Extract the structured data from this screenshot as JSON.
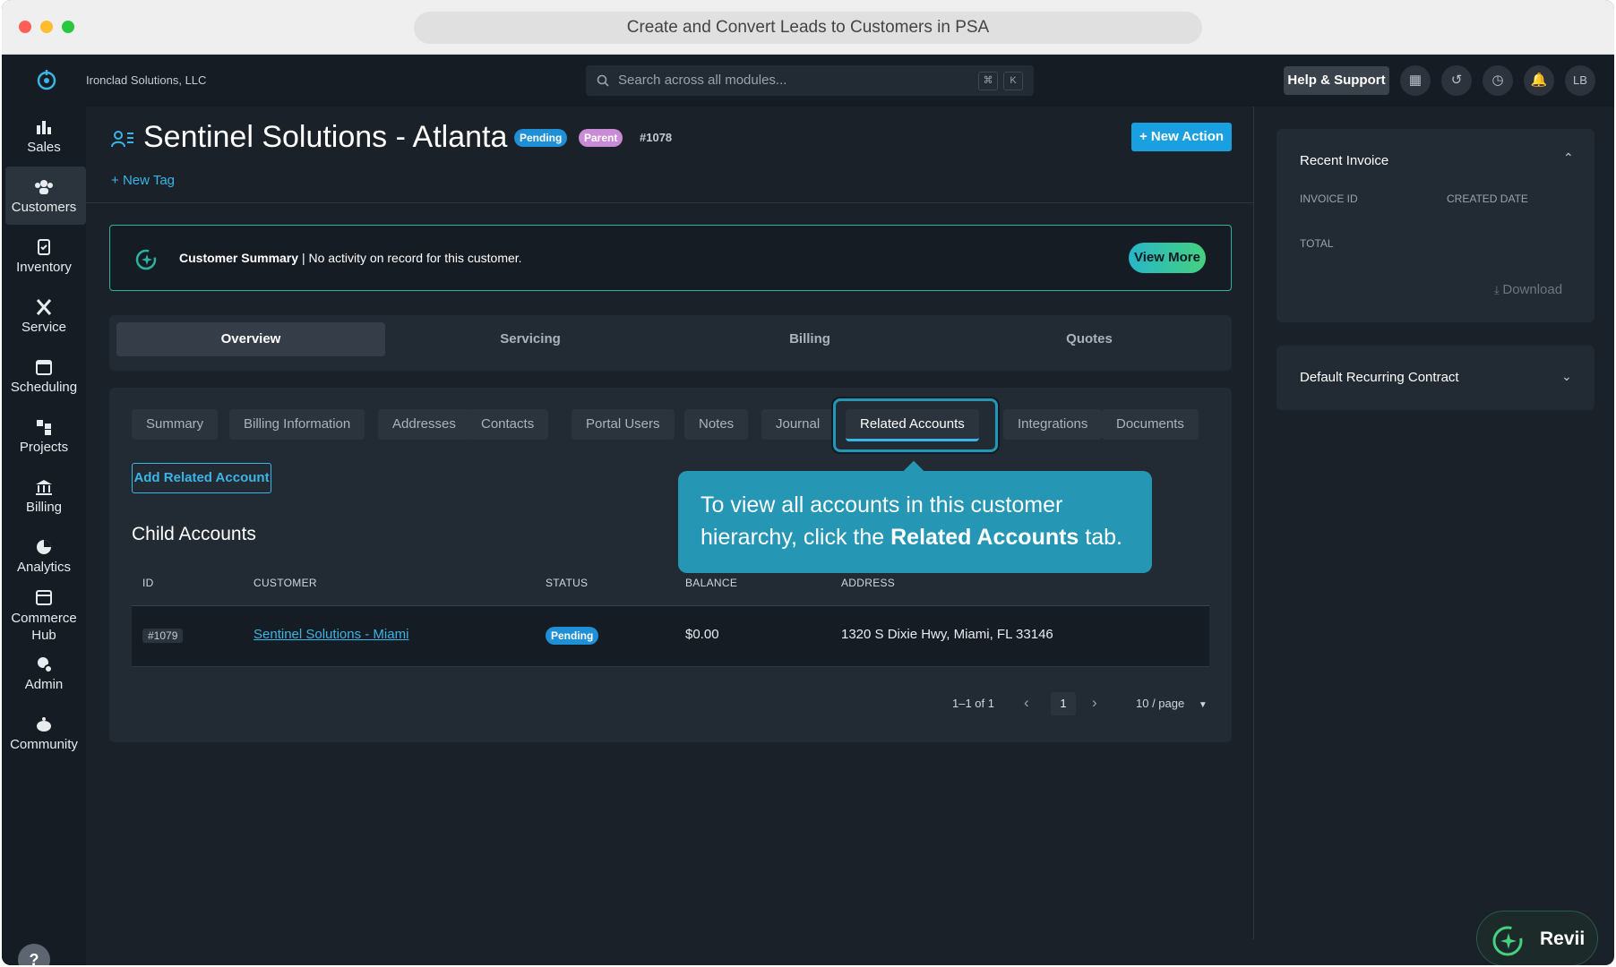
{
  "window": {
    "title": "Create and Convert Leads to Customers in PSA"
  },
  "header": {
    "org_name": "Ironclad Solutions, LLC",
    "search_placeholder": "Search across all modules...",
    "shortcut_keys": [
      "⌘",
      "K"
    ],
    "help_label": "Help & Support",
    "avatar_initials": "LB"
  },
  "sidebar": {
    "items": [
      {
        "label": "Sales",
        "icon": "bar-chart-icon"
      },
      {
        "label": "Customers",
        "icon": "users-icon",
        "active": true
      },
      {
        "label": "Inventory",
        "icon": "clipboard-icon"
      },
      {
        "label": "Service",
        "icon": "tools-icon"
      },
      {
        "label": "Scheduling",
        "icon": "calendar-icon"
      },
      {
        "label": "Projects",
        "icon": "projects-icon"
      },
      {
        "label": "Billing",
        "icon": "bank-icon"
      },
      {
        "label": "Analytics",
        "icon": "pie-chart-icon"
      },
      {
        "label": "Commerce",
        "label2": "Hub",
        "icon": "store-icon"
      },
      {
        "label": "Admin",
        "icon": "admin-icon"
      },
      {
        "label": "Community",
        "icon": "community-icon"
      }
    ],
    "help_glyph": "?"
  },
  "customer": {
    "name": "Sentinel Solutions - Atlanta",
    "status_badge": "Pending",
    "type_badge": "Parent",
    "number": "#1078",
    "new_tag_label": "New Tag",
    "new_action_label": "New Action"
  },
  "summary": {
    "title": "Customer Summary",
    "separator": "|",
    "message": "No activity on record for this customer.",
    "view_more": "View More"
  },
  "main_tabs": [
    "Overview",
    "Servicing",
    "Billing",
    "Quotes"
  ],
  "sub_tabs": [
    "Summary",
    "Billing Information",
    "Addresses",
    "Contacts",
    "Portal Users",
    "Notes",
    "Journal",
    "Related Accounts",
    "Integrations",
    "Documents"
  ],
  "related": {
    "add_button": "Add Related Account",
    "section_title": "Child Accounts",
    "columns": [
      "ID",
      "CUSTOMER",
      "STATUS",
      "BALANCE",
      "ADDRESS"
    ],
    "rows": [
      {
        "id": "#1079",
        "customer": "Sentinel Solutions - Miami",
        "status": "Pending",
        "balance": "$0.00",
        "address": "1320 S Dixie Hwy, Miami, FL 33146"
      }
    ],
    "pagination": {
      "range": "1–1 of 1",
      "page": "1",
      "page_size": "10 / page"
    }
  },
  "tooltip": {
    "line1": "To view all accounts in this customer",
    "line2_pre": "hierarchy, click the ",
    "line2_bold": "Related Accounts",
    "line2_post": " tab."
  },
  "right_panel": {
    "recent_invoice": {
      "title": "Recent Invoice",
      "invoice_id_label": "INVOICE ID",
      "created_date_label": "CREATED DATE",
      "total_label": "TOTAL",
      "download_label": "Download"
    },
    "recurring_contract": {
      "title": "Default Recurring Contract"
    }
  },
  "assistant": {
    "label": "Revii"
  },
  "colors": {
    "accent": "#1aa0e0",
    "teal": "#2ab3a0",
    "pending": "#1f8fd6",
    "parent": "#c98ad6",
    "tooltip": "#2596b4"
  }
}
